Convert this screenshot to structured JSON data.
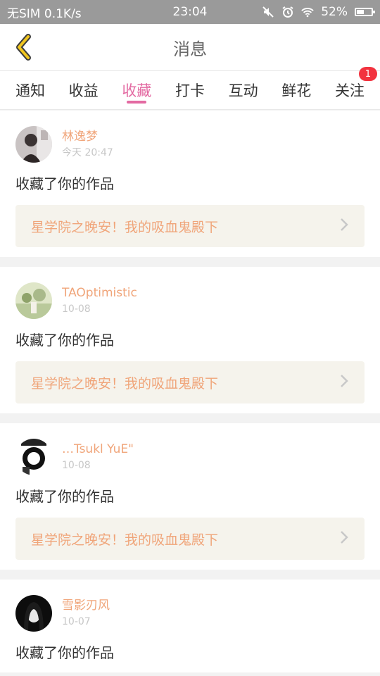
{
  "status_bar": {
    "carrier": "无SIM",
    "speed": "0.1K/s",
    "time": "23:04",
    "battery": "52%",
    "battery_level": 0.52,
    "icons": [
      "mute-icon",
      "alarm-icon",
      "wifi-icon",
      "battery-icon"
    ]
  },
  "header": {
    "title": "消息",
    "back_icon": "chevron-left-icon"
  },
  "tabs": [
    {
      "label": "通知"
    },
    {
      "label": "收益"
    },
    {
      "label": "收藏",
      "active": true
    },
    {
      "label": "打卡"
    },
    {
      "label": "互动"
    },
    {
      "label": "鲜花"
    },
    {
      "label": "关注",
      "badge": "1"
    }
  ],
  "colors": {
    "accent": "#e36aa2",
    "username": "#f0a57a",
    "badge": "#f2333f",
    "link_bg": "#f5f3ec"
  },
  "feed": [
    {
      "user": "林逸梦",
      "time": "今天 20:47",
      "action": "收藏了你的作品",
      "work": "星学院之晚安！我的吸血鬼殿下"
    },
    {
      "user": "TAOptimistic",
      "time": "10-08",
      "action": "收藏了你的作品",
      "work": "星学院之晚安！我的吸血鬼殿下"
    },
    {
      "user": "…Tsukl YuE\"",
      "time": "10-08",
      "action": "收藏了你的作品",
      "work": "星学院之晚安！我的吸血鬼殿下"
    },
    {
      "user": "雪影刃风",
      "time": "10-07",
      "action": "收藏了你的作品"
    }
  ]
}
